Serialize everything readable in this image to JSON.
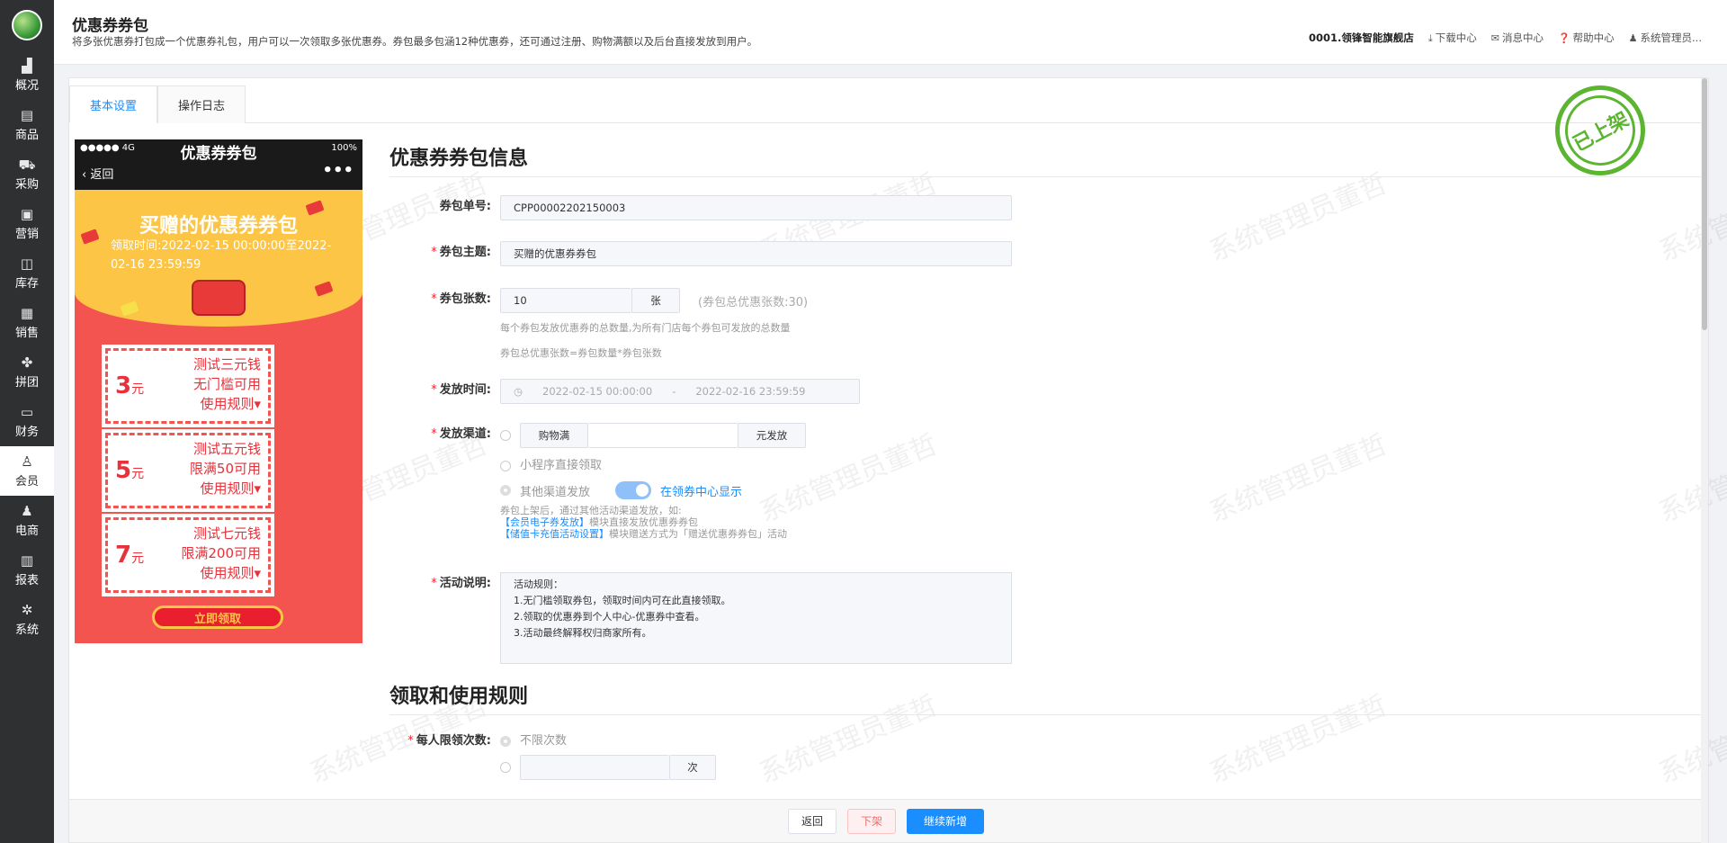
{
  "sidebar": {
    "items": [
      {
        "label": "概况",
        "icon": "chart-icon"
      },
      {
        "label": "商品",
        "icon": "document-icon"
      },
      {
        "label": "采购",
        "icon": "cart-icon"
      },
      {
        "label": "营销",
        "icon": "bag-icon"
      },
      {
        "label": "库存",
        "icon": "box-icon"
      },
      {
        "label": "销售",
        "icon": "printer-icon"
      },
      {
        "label": "拼团",
        "icon": "grid-icon"
      },
      {
        "label": "财务",
        "icon": "wallet-icon"
      },
      {
        "label": "会员",
        "icon": "user-icon"
      },
      {
        "label": "电商",
        "icon": "user-icon"
      },
      {
        "label": "报表",
        "icon": "report-icon"
      },
      {
        "label": "系统",
        "icon": "gear-icon"
      }
    ],
    "active": "会员"
  },
  "header": {
    "title": "优惠券券包",
    "description": "将多张优惠券打包成一个优惠券礼包，用户可以一次领取多张优惠券。券包最多包涵12种优惠券，还可通过注册、购物满额以及后台直接发放到用户。",
    "store": "0001.领锋智能旗舰店",
    "download": "下载中心",
    "message": "消息中心",
    "help": "帮助中心",
    "user": "系统管理员..."
  },
  "tabs": [
    "基本设置",
    "操作日志"
  ],
  "stamp": "已上架",
  "watermark": "系统管理员董哲",
  "phone": {
    "signal": "●●●●● 4G",
    "battery": "100%",
    "title": "优惠券券包",
    "back": "返回",
    "banner_title": "买赠的优惠券券包",
    "banner_time": "领取时间:2022-02-15 00:00:00至2022-02-16 23:59:59",
    "coupons": [
      {
        "amount": "3",
        "unit": "元",
        "name": "测试三元钱",
        "cond": "无门槛可用",
        "rule": "使用规则"
      },
      {
        "amount": "5",
        "unit": "元",
        "name": "测试五元钱",
        "cond": "限满50可用",
        "rule": "使用规则"
      },
      {
        "amount": "7",
        "unit": "元",
        "name": "测试七元钱",
        "cond": "限满200可用",
        "rule": "使用规则"
      }
    ],
    "button": "立即领取"
  },
  "form": {
    "section1": "优惠券券包信息",
    "code_label": "券包单号:",
    "code_value": "CPP00002202150003",
    "theme_label": "券包主题:",
    "theme_value": "买赠的优惠券券包",
    "count_label": "券包张数:",
    "count_value": "10",
    "count_unit": "张",
    "count_total": "(券包总优惠张数:30)",
    "count_hint1": "每个券包发放优惠券的总数量,为所有门店每个券包可发放的总数量",
    "count_hint2": "券包总优惠张数=券包数量*券包张数",
    "time_label": "发放时间:",
    "time_start": "2022-02-15 00:00:00",
    "time_sep": "-",
    "time_end": "2022-02-16 23:59:59",
    "channel_label": "发放渠道:",
    "channel_buy": "购物满",
    "channel_buy_unit": "元发放",
    "channel_mini": "小程序直接领取",
    "channel_other": "其他渠道发放",
    "channel_show": "在领券中心显示",
    "channel_hint1": "券包上架后，通过其他活动渠道发放，如:",
    "channel_link1": "【会员电子券发放】",
    "channel_hint2": "模块直接发放优惠券券包",
    "channel_link2": "【储值卡充值活动设置】",
    "channel_hint3": "模块赠送方式为「赠送优惠券券包」活动",
    "desc_label": "活动说明:",
    "desc_value": "活动规则：\n1.无门槛领取券包，领取时间内可在此直接领取。\n2.领取的优惠券到个人中心-优惠券中查看。\n3.活动最终解释权归商家所有。",
    "section2": "领取和使用规则",
    "limit_label": "每人限领次数:",
    "limit_unlimited": "不限次数",
    "limit_unit": "次"
  },
  "footer": {
    "back": "返回",
    "offline": "下架",
    "add": "继续新增"
  }
}
